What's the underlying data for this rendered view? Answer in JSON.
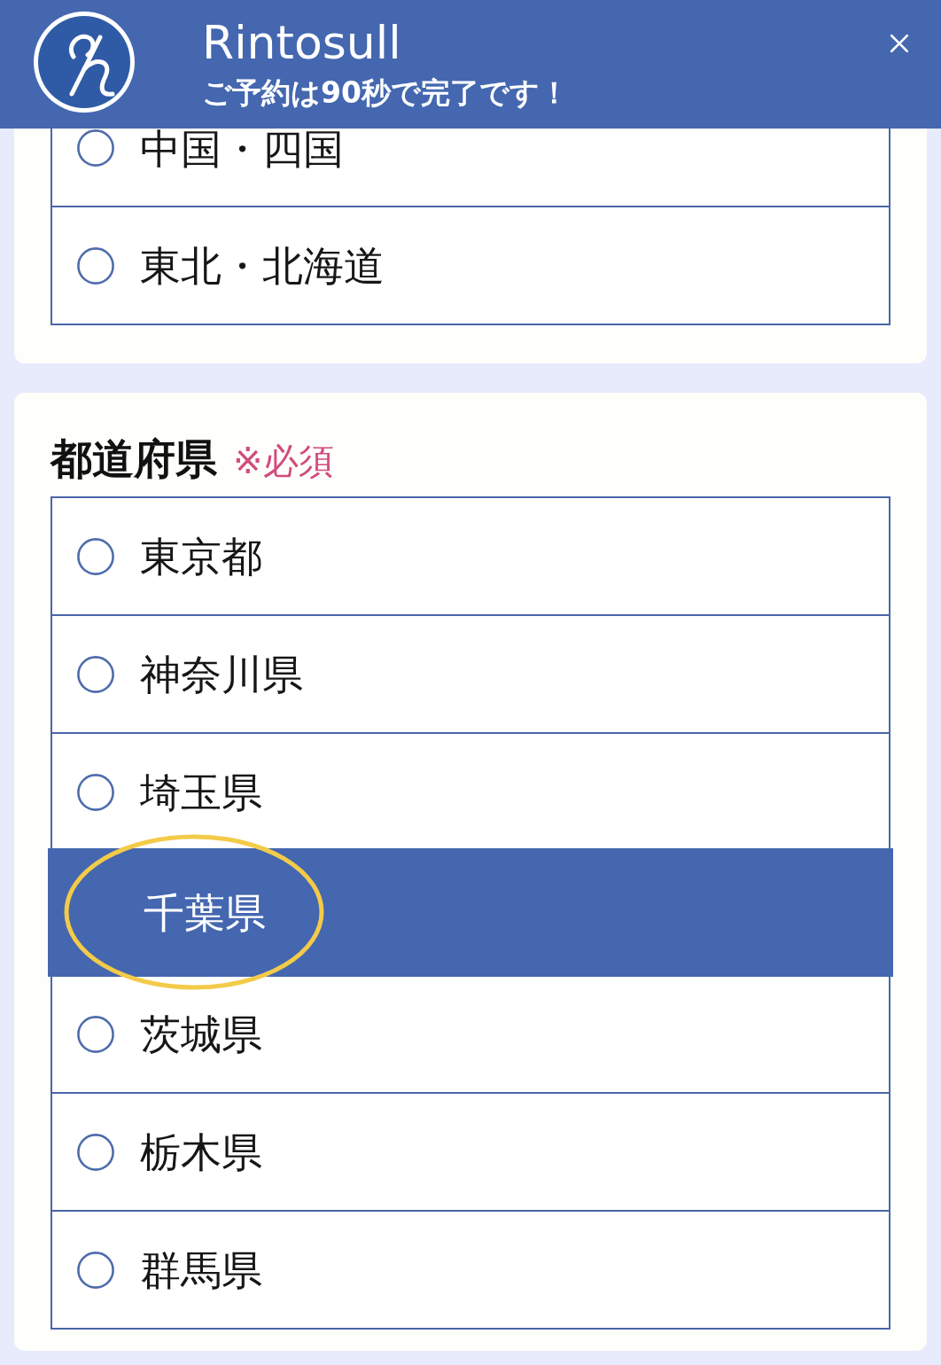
{
  "header": {
    "title": "Rintosull",
    "subtitle": "ご予約は90秒で完了です！"
  },
  "area_section": {
    "options": [
      {
        "label": "中国・四国",
        "selected": false
      },
      {
        "label": "東北・北海道",
        "selected": false
      }
    ]
  },
  "prefecture_section": {
    "label": "都道府県",
    "required_mark": "※必須",
    "options": [
      {
        "label": "東京都",
        "selected": false,
        "circled": false
      },
      {
        "label": "神奈川県",
        "selected": false,
        "circled": false
      },
      {
        "label": "埼玉県",
        "selected": false,
        "circled": false
      },
      {
        "label": "千葉県",
        "selected": true,
        "circled": true
      },
      {
        "label": "茨城県",
        "selected": false,
        "circled": false
      },
      {
        "label": "栃木県",
        "selected": false,
        "circled": false
      },
      {
        "label": "群馬県",
        "selected": false,
        "circled": false
      }
    ]
  }
}
